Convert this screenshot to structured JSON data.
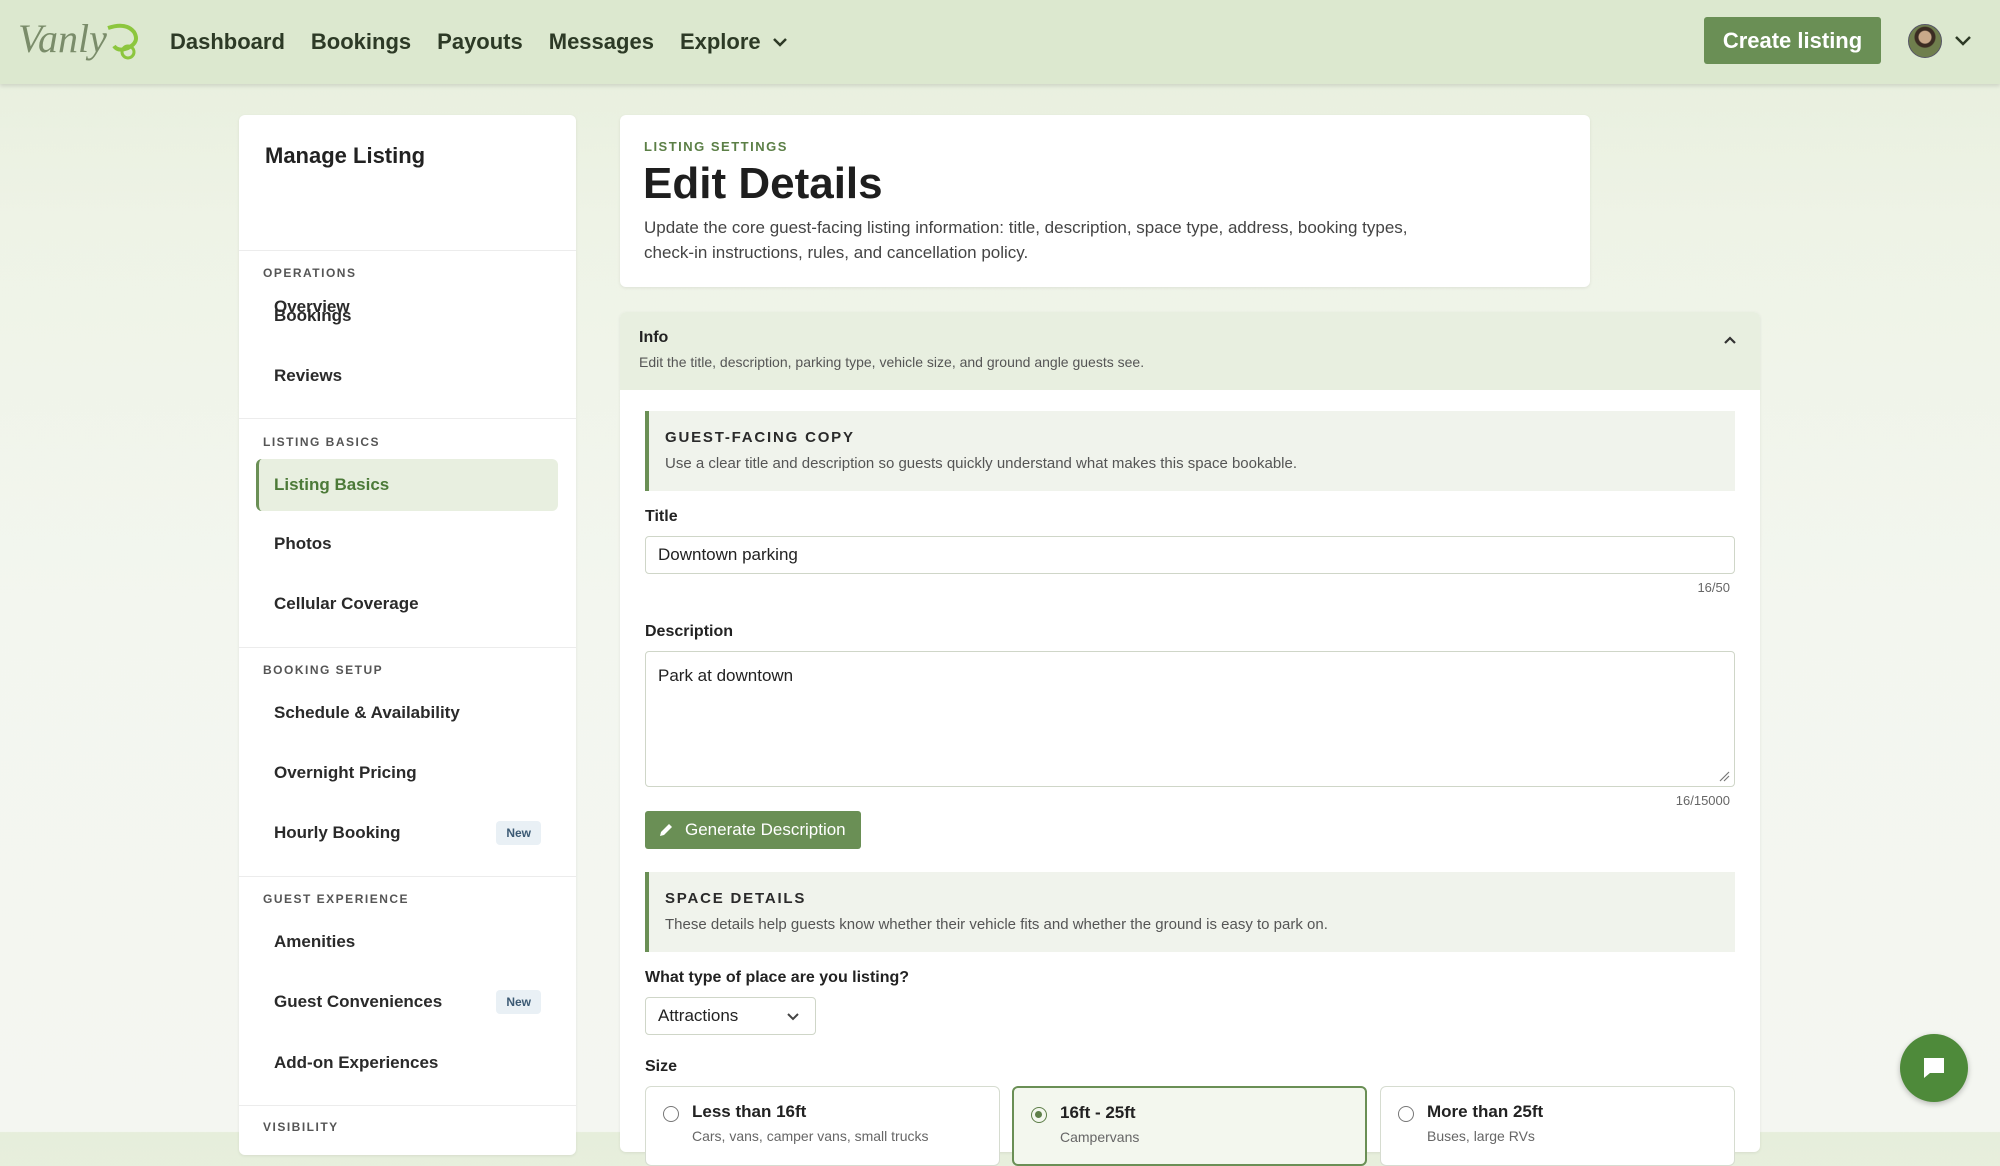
{
  "app": {
    "logo_text": "Vanly"
  },
  "nav": {
    "items": [
      "Dashboard",
      "Bookings",
      "Payouts",
      "Messages",
      "Explore"
    ],
    "create_label": "Create listing"
  },
  "sidebar": {
    "title": "Manage Listing",
    "overview": "Overview",
    "sections": {
      "operations": "OPERATIONS",
      "listing_basics": "LISTING BASICS",
      "booking_setup": "BOOKING SETUP",
      "guest_experience": "GUEST EXPERIENCE",
      "visibility": "VISIBILITY"
    },
    "items": {
      "bookings": "Bookings",
      "reviews": "Reviews",
      "listing_basics": "Listing Basics",
      "photos": "Photos",
      "cellular": "Cellular Coverage",
      "schedule": "Schedule & Availability",
      "overnight": "Overnight Pricing",
      "hourly": "Hourly Booking",
      "amenities": "Amenities",
      "conveniences": "Guest Conveniences",
      "addons": "Add-on Experiences"
    },
    "badge_new": "New"
  },
  "header": {
    "eyebrow": "LISTING SETTINGS",
    "title": "Edit Details",
    "description": "Update the core guest-facing listing information: title, description, space type, address, booking types, check-in instructions, rules, and cancellation policy."
  },
  "info": {
    "title": "Info",
    "subtitle": "Edit the title, description, parking type, vehicle size, and ground angle guests see.",
    "copy_callout": {
      "title": "GUEST-FACING COPY",
      "text": "Use a clear title and description so guests quickly understand what makes this space bookable."
    },
    "title_label": "Title",
    "title_value": "Downtown parking",
    "title_counter": "16/50",
    "description_label": "Description",
    "description_value": "Park at downtown",
    "description_counter": "16/15000",
    "generate_label": "Generate Description",
    "space_callout": {
      "title": "SPACE DETAILS",
      "text": "These details help guests know whether their vehicle fits and whether the ground is easy to park on."
    },
    "place_type_label": "What type of place are you listing?",
    "place_type_value": "Attractions",
    "size_label": "Size",
    "sizes": [
      {
        "label": "Less than 16ft",
        "sub": "Cars, vans, camper vans, small trucks",
        "selected": false
      },
      {
        "label": "16ft - 25ft",
        "sub": "Campervans",
        "selected": true
      },
      {
        "label": "More than 25ft",
        "sub": "Buses, large RVs",
        "selected": false
      }
    ]
  },
  "colors": {
    "accent": "#6a8f55",
    "topbar": "#dce8cf",
    "active_bg": "#e8efe0"
  }
}
